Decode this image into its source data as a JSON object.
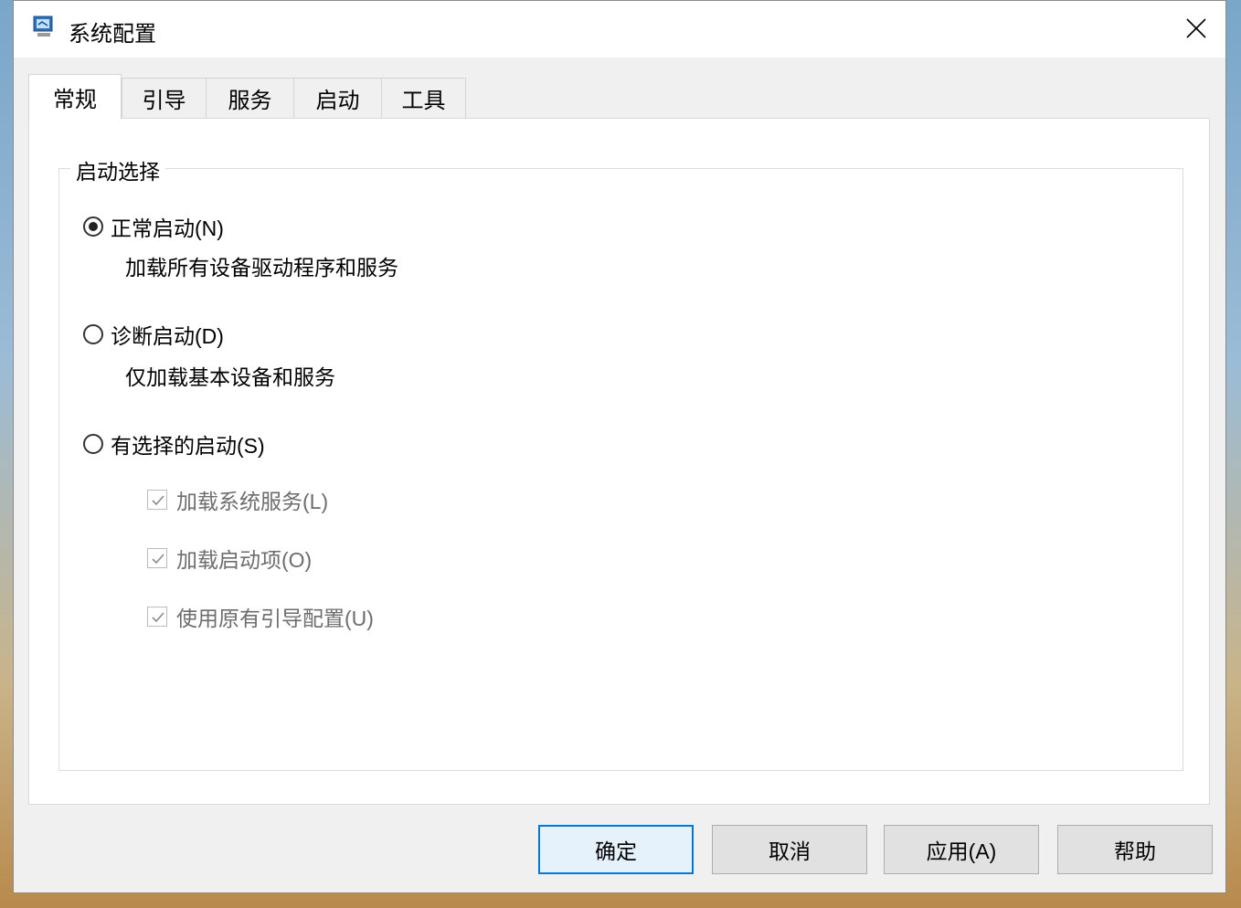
{
  "window": {
    "title": "系统配置"
  },
  "tabs": [
    {
      "label": "常规",
      "active": true
    },
    {
      "label": "引导",
      "active": false
    },
    {
      "label": "服务",
      "active": false
    },
    {
      "label": "启动",
      "active": false
    },
    {
      "label": "工具",
      "active": false
    }
  ],
  "startup": {
    "group_label": "启动选择",
    "options": [
      {
        "label": "正常启动(N)",
        "description": "加载所有设备驱动程序和服务",
        "selected": true
      },
      {
        "label": "诊断启动(D)",
        "description": "仅加载基本设备和服务",
        "selected": false
      },
      {
        "label": "有选择的启动(S)",
        "selected": false
      }
    ],
    "selective_items": [
      {
        "label": "加载系统服务(L)",
        "checked": true,
        "enabled": false
      },
      {
        "label": "加载启动项(O)",
        "checked": true,
        "enabled": false
      },
      {
        "label": "使用原有引导配置(U)",
        "checked": true,
        "enabled": false
      }
    ]
  },
  "buttons": {
    "ok": "确定",
    "cancel": "取消",
    "apply": "应用(A)",
    "help": "帮助"
  },
  "colors": {
    "accent": "#0078d7",
    "disabled_text": "#6d6d6d"
  }
}
